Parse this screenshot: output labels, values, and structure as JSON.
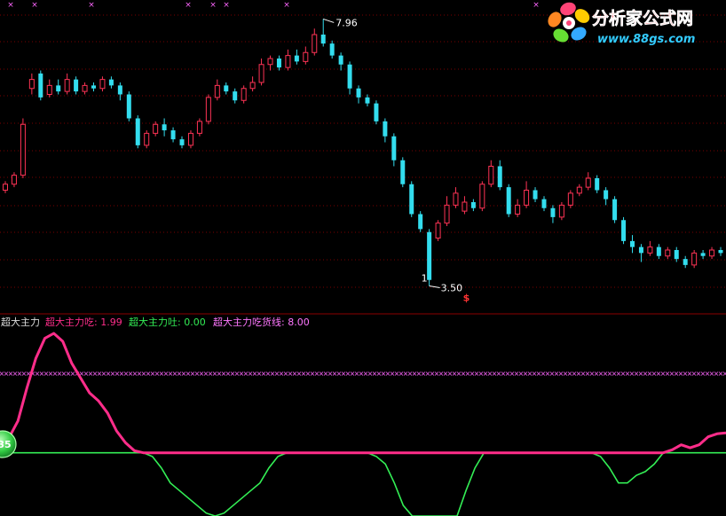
{
  "watermark": {
    "cn_text": "分析家公式网",
    "url_text": "www.88gs.com"
  },
  "colors": {
    "up": "#ff3355",
    "down": "#33ddee",
    "eat_line": "#ff2d8a",
    "spit_line": "#33ee55",
    "threshold": "#ff66ff",
    "divider": "#8b0000",
    "grid": "#7a0000"
  },
  "price_annotations": {
    "high_label": "7.96",
    "low_label": "3.50",
    "marker_glyph": "$",
    "tick_one": "1",
    "badge": "35"
  },
  "legend": {
    "title": "超大主力",
    "eat_text": "超大主力吃: 1.99",
    "spit_text": "超大主力吐: 0.00",
    "line_text": "超大主力吃货线: 8.00"
  },
  "chart_data": [
    {
      "type": "candlestick",
      "title": "",
      "ylim": [
        3.3,
        8.1
      ],
      "grid": true,
      "high": 7.96,
      "low": 3.5,
      "candles": [
        [
          5.1,
          5.2,
          5.25,
          5.05
        ],
        [
          5.2,
          5.35,
          5.4,
          5.15
        ],
        [
          5.35,
          6.2,
          6.3,
          5.3
        ],
        [
          6.8,
          6.95,
          7.05,
          6.7
        ],
        [
          7.05,
          6.65,
          7.1,
          6.6
        ],
        [
          6.7,
          6.85,
          6.95,
          6.65
        ],
        [
          6.85,
          6.75,
          6.95,
          6.7
        ],
        [
          6.75,
          6.95,
          7.05,
          6.7
        ],
        [
          6.95,
          6.75,
          7.0,
          6.7
        ],
        [
          6.75,
          6.85,
          6.9,
          6.7
        ],
        [
          6.85,
          6.8,
          6.9,
          6.75
        ],
        [
          6.8,
          6.95,
          7.0,
          6.75
        ],
        [
          6.95,
          6.85,
          7.0,
          6.8
        ],
        [
          6.85,
          6.7,
          6.9,
          6.6
        ],
        [
          6.7,
          6.3,
          6.75,
          6.25
        ],
        [
          6.3,
          5.85,
          6.35,
          5.8
        ],
        [
          5.85,
          6.05,
          6.1,
          5.8
        ],
        [
          6.05,
          6.2,
          6.25,
          6.0
        ],
        [
          6.2,
          6.1,
          6.3,
          6.0
        ],
        [
          6.1,
          5.95,
          6.15,
          5.9
        ],
        [
          5.95,
          5.85,
          6.0,
          5.8
        ],
        [
          5.85,
          6.05,
          6.1,
          5.8
        ],
        [
          6.05,
          6.25,
          6.3,
          6.0
        ],
        [
          6.25,
          6.65,
          6.7,
          6.2
        ],
        [
          6.65,
          6.85,
          6.95,
          6.6
        ],
        [
          6.85,
          6.75,
          6.9,
          6.7
        ],
        [
          6.75,
          6.6,
          6.8,
          6.55
        ],
        [
          6.6,
          6.8,
          6.85,
          6.55
        ],
        [
          6.8,
          6.9,
          7.0,
          6.75
        ],
        [
          6.9,
          7.2,
          7.3,
          6.85
        ],
        [
          7.2,
          7.3,
          7.35,
          7.1
        ],
        [
          7.3,
          7.15,
          7.35,
          7.1
        ],
        [
          7.15,
          7.35,
          7.45,
          7.1
        ],
        [
          7.35,
          7.25,
          7.45,
          7.2
        ],
        [
          7.25,
          7.4,
          7.5,
          7.2
        ],
        [
          7.4,
          7.7,
          7.8,
          7.35
        ],
        [
          7.7,
          7.55,
          7.96,
          7.5
        ],
        [
          7.55,
          7.35,
          7.6,
          7.3
        ],
        [
          7.35,
          7.2,
          7.4,
          7.1
        ],
        [
          7.2,
          6.8,
          7.25,
          6.7
        ],
        [
          6.8,
          6.65,
          6.85,
          6.55
        ],
        [
          6.65,
          6.55,
          6.7,
          6.5
        ],
        [
          6.55,
          6.25,
          6.6,
          6.2
        ],
        [
          6.25,
          6.0,
          6.3,
          5.9
        ],
        [
          6.0,
          5.6,
          6.05,
          5.5
        ],
        [
          5.6,
          5.2,
          5.65,
          5.15
        ],
        [
          5.2,
          4.7,
          5.25,
          4.65
        ],
        [
          4.7,
          4.45,
          4.75,
          4.4
        ],
        [
          4.4,
          3.6,
          4.45,
          3.5
        ],
        [
          4.3,
          4.55,
          4.6,
          4.25
        ],
        [
          4.55,
          4.85,
          5.0,
          4.5
        ],
        [
          4.85,
          5.05,
          5.15,
          4.8
        ],
        [
          4.75,
          4.9,
          5.0,
          4.7
        ],
        [
          4.9,
          4.8,
          4.95,
          4.75
        ],
        [
          4.8,
          5.2,
          5.25,
          4.75
        ],
        [
          5.2,
          5.5,
          5.6,
          5.15
        ],
        [
          5.5,
          5.15,
          5.6,
          5.1
        ],
        [
          5.15,
          4.7,
          5.2,
          4.65
        ],
        [
          4.7,
          4.85,
          4.95,
          4.65
        ],
        [
          4.85,
          5.1,
          5.25,
          4.8
        ],
        [
          5.1,
          4.95,
          5.15,
          4.9
        ],
        [
          4.95,
          4.8,
          5.0,
          4.75
        ],
        [
          4.8,
          4.65,
          4.85,
          4.55
        ],
        [
          4.65,
          4.85,
          4.9,
          4.6
        ],
        [
          4.85,
          5.05,
          5.1,
          4.8
        ],
        [
          5.05,
          5.15,
          5.2,
          5.0
        ],
        [
          5.15,
          5.3,
          5.4,
          5.1
        ],
        [
          5.3,
          5.1,
          5.35,
          5.05
        ],
        [
          5.1,
          4.95,
          5.15,
          4.85
        ],
        [
          4.95,
          4.6,
          5.0,
          4.55
        ],
        [
          4.6,
          4.25,
          4.65,
          4.2
        ],
        [
          4.25,
          4.15,
          4.35,
          4.05
        ],
        [
          4.15,
          4.05,
          4.2,
          3.9
        ],
        [
          4.05,
          4.15,
          4.25,
          4.0
        ],
        [
          4.15,
          4.0,
          4.2,
          3.95
        ],
        [
          4.0,
          4.1,
          4.15,
          3.95
        ],
        [
          4.1,
          3.95,
          4.15,
          3.9
        ],
        [
          3.95,
          3.85,
          4.0,
          3.8
        ],
        [
          3.85,
          4.05,
          4.1,
          3.8
        ],
        [
          4.05,
          4.0,
          4.1,
          3.95
        ],
        [
          4.0,
          4.1,
          4.15,
          3.95
        ],
        [
          4.1,
          4.05,
          4.15,
          4.0
        ]
      ]
    },
    {
      "type": "line",
      "title": "超大主力",
      "ylim": [
        0,
        12
      ],
      "series": [
        {
          "name": "超大主力吃",
          "values": [
            0.5,
            1.5,
            3.2,
            6.5,
            9.5,
            11.5,
            12.0,
            11.2,
            9.0,
            7.5,
            6.0,
            5.2,
            4.0,
            2.2,
            1.0,
            0.2,
            0.0,
            0.0,
            0.0,
            0.0,
            0.0,
            0.0,
            0.0,
            0.0,
            0.0,
            0.0,
            0.0,
            0.0,
            0.0,
            0.0,
            0.0,
            0.0,
            0.0,
            0.0,
            0.0,
            0.0,
            0.0,
            0.0,
            0.0,
            0.0,
            0.0,
            0.0,
            0.0,
            0.0,
            0.0,
            0.0,
            0.0,
            0.0,
            0.0,
            0.0,
            0.0,
            0.0,
            0.0,
            0.0,
            0.0,
            0.0,
            0.0,
            0.0,
            0.0,
            0.0,
            0.0,
            0.0,
            0.0,
            0.0,
            0.0,
            0.0,
            0.0,
            0.0,
            0.0,
            0.0,
            0.0,
            0.0,
            0.0,
            0.0,
            0.0,
            0.3,
            0.8,
            0.5,
            0.8,
            1.6,
            1.9,
            1.99
          ]
        },
        {
          "name": "超大主力吐",
          "values": [
            0,
            0,
            0,
            0,
            0,
            0,
            0,
            0,
            0,
            0,
            0,
            0,
            0,
            0,
            0,
            0,
            0,
            -0.5,
            -2,
            -4,
            -5,
            -6,
            -7,
            -8,
            -8.5,
            -8,
            -7,
            -6,
            -5,
            -4,
            -2,
            -0.5,
            0,
            0,
            0,
            0,
            0,
            0,
            0,
            0,
            0,
            0,
            -0.5,
            -1.5,
            -4,
            -7,
            -10,
            -12,
            -14,
            -15,
            -13,
            -9,
            -5,
            -2,
            0,
            0,
            0,
            0,
            0,
            0,
            0,
            0,
            0,
            0,
            0,
            0,
            0,
            -0.5,
            -2,
            -4,
            -4,
            -3,
            -2.5,
            -1.5,
            0,
            0,
            0,
            0,
            0,
            0,
            0,
            0
          ]
        },
        {
          "name": "超大主力吃货线",
          "values": [
            8,
            8,
            8,
            8,
            8,
            8,
            8,
            8,
            8,
            8,
            8,
            8,
            8,
            8,
            8,
            8,
            8,
            8,
            8,
            8,
            8,
            8,
            8,
            8,
            8,
            8,
            8,
            8,
            8,
            8,
            8,
            8,
            8,
            8,
            8,
            8,
            8,
            8,
            8,
            8,
            8,
            8,
            8,
            8,
            8,
            8,
            8,
            8,
            8,
            8,
            8,
            8,
            8,
            8,
            8,
            8,
            8,
            8,
            8,
            8,
            8,
            8,
            8,
            8,
            8,
            8,
            8,
            8,
            8,
            8,
            8,
            8,
            8,
            8,
            8,
            8,
            8,
            8,
            8,
            8,
            8,
            8
          ]
        }
      ]
    }
  ]
}
